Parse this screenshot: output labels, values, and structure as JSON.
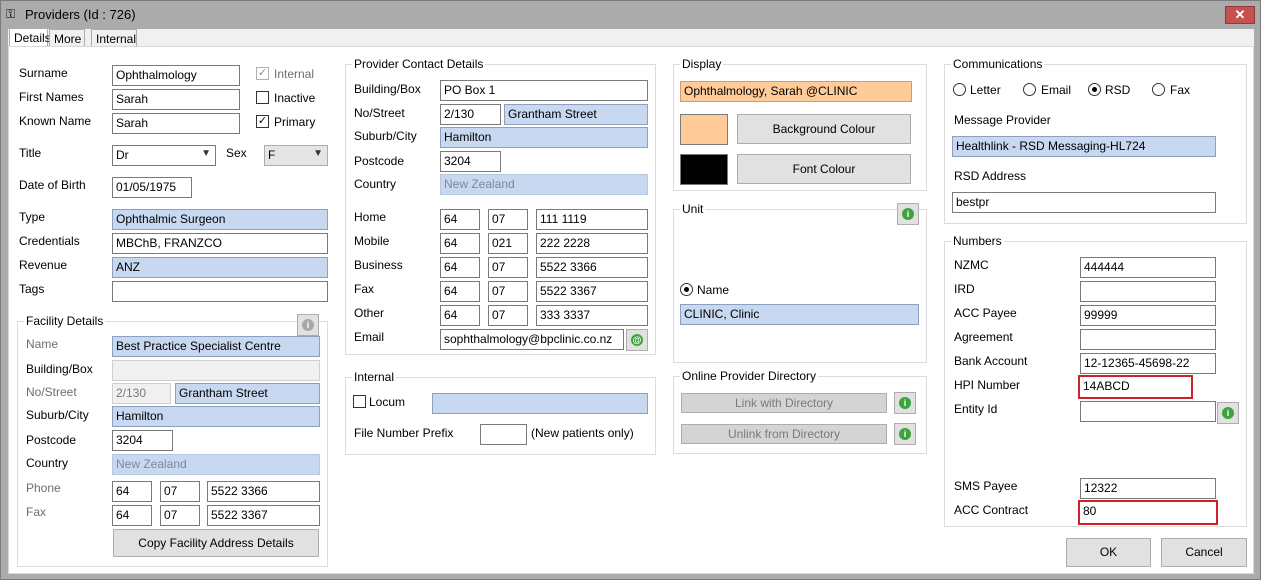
{
  "window": {
    "title": "Providers (Id : 726)",
    "close_glyph": "✕"
  },
  "tabs": [
    "Details",
    "More",
    "Internal"
  ],
  "person": {
    "surname_label": "Surname",
    "surname": "Ophthalmology",
    "first_label": "First Names",
    "first": "Sarah",
    "known_label": "Known Name",
    "known": "Sarah",
    "internal_label": "Internal",
    "inactive_label": "Inactive",
    "primary_label": "Primary",
    "internal_checked": true,
    "inactive_checked": false,
    "primary_checked": true,
    "title_label": "Title",
    "title": "Dr",
    "sex_label": "Sex",
    "sex": "F",
    "dob_label": "Date of Birth",
    "dob": "01/05/1975",
    "type_label": "Type",
    "type": "Ophthalmic Surgeon",
    "cred_label": "Credentials",
    "cred": "MBChB, FRANZCO",
    "revenue_label": "Revenue",
    "revenue": "ANZ",
    "tags_label": "Tags",
    "tags": ""
  },
  "facility": {
    "group": "Facility Details",
    "name_label": "Name",
    "name": "Best Practice Specialist Centre",
    "box_label": "Building/Box",
    "box": "",
    "no_label": "No/Street",
    "no": "2/130",
    "street": "Grantham Street",
    "suburb_label": "Suburb/City",
    "suburb": "Hamilton",
    "postcode_label": "Postcode",
    "postcode": "3204",
    "country_label": "Country",
    "country": "New Zealand",
    "phone_label": "Phone",
    "phone": [
      "64",
      "07",
      "5522 3366"
    ],
    "fax_label": "Fax",
    "fax": [
      "64",
      "07",
      "5522 3367"
    ],
    "copy_button": "Copy Facility Address Details"
  },
  "contact": {
    "group": "Provider Contact Details",
    "box_label": "Building/Box",
    "box": "PO Box 1",
    "no_label": "No/Street",
    "no": "2/130",
    "street": "Grantham Street",
    "suburb_label": "Suburb/City",
    "suburb": "Hamilton",
    "postcode_label": "Postcode",
    "postcode": "3204",
    "country_label": "Country",
    "country": "New Zealand",
    "home_label": "Home",
    "home": [
      "64",
      "07",
      "111 1119"
    ],
    "mobile_label": "Mobile",
    "mobile": [
      "64",
      "021",
      "222 2228"
    ],
    "business_label": "Business",
    "business": [
      "64",
      "07",
      "5522 3366"
    ],
    "fax_label": "Fax",
    "fax": [
      "64",
      "07",
      "5522 3367"
    ],
    "other_label": "Other",
    "other": [
      "64",
      "07",
      "333 3337"
    ],
    "email_label": "Email",
    "email": "sophthalmology@bpclinic.co.nz"
  },
  "internal": {
    "group": "Internal",
    "locum_label": "Locum",
    "locum_checked": false,
    "locum": "",
    "prefix_label": "File Number Prefix",
    "prefix": "",
    "prefix_note": "(New patients only)"
  },
  "display": {
    "group": "Display",
    "name": "Ophthalmology, Sarah @CLINIC",
    "bg_button": "Background Colour",
    "font_button": "Font Colour",
    "bg_color": "#ffcc99",
    "font_color": "#000000"
  },
  "unit": {
    "group": "Unit",
    "name_label": "Name",
    "name": "CLINIC, Clinic"
  },
  "directory": {
    "group": "Online Provider Directory",
    "link_button": "Link with Directory",
    "unlink_button": "Unlink from Directory"
  },
  "comms": {
    "group": "Communications",
    "options": [
      "Letter",
      "Email",
      "RSD",
      "Fax"
    ],
    "selected": "RSD",
    "provider_label": "Message Provider",
    "provider": "Healthlink - RSD Messaging-HL724",
    "rsd_label": "RSD Address",
    "rsd": "bestpr"
  },
  "numbers": {
    "group": "Numbers",
    "nzmc_label": "NZMC",
    "nzmc": "444444",
    "ird_label": "IRD",
    "ird": "",
    "accpayee_label": "ACC Payee",
    "accpayee": "99999",
    "agreement_label": "Agreement",
    "agreement": "",
    "bank_label": "Bank Account",
    "bank": "12-12365-45698-22",
    "hpi_label": "HPI Number",
    "hpi": "14ABCD",
    "entity_label": "Entity Id",
    "entity": "",
    "sms_label": "SMS Payee",
    "sms": "12322",
    "acccontract_label": "ACC Contract",
    "acccontract": "80"
  },
  "buttons": {
    "ok": "OK",
    "cancel": "Cancel"
  }
}
